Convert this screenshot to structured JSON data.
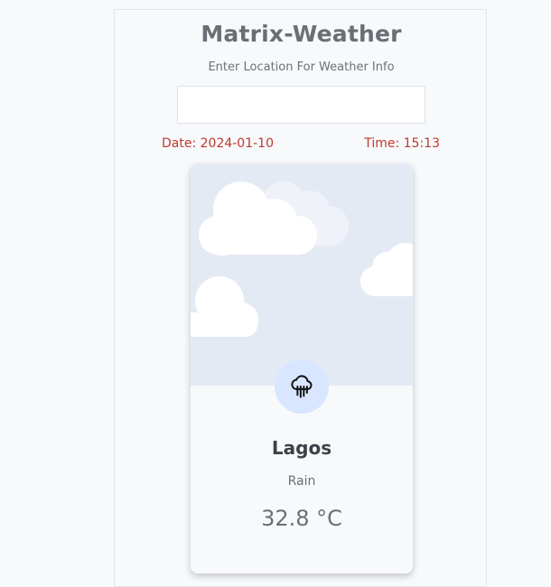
{
  "app": {
    "title": "Matrix-Weather",
    "subtitle": "Enter Location For Weather Info"
  },
  "search": {
    "value": "",
    "placeholder": ""
  },
  "datetime": {
    "date_text": "Date: 2024-01-10",
    "time_text": "Time: 15:13"
  },
  "weather_card": {
    "city": "Lagos",
    "condition": "Rain",
    "temperature": "32.8 °C",
    "icon": "cloud-rain-icon"
  },
  "colors": {
    "accent_red": "#c0392b",
    "sky": "#e4eaf4",
    "icon_circle": "#d9e6ff"
  }
}
